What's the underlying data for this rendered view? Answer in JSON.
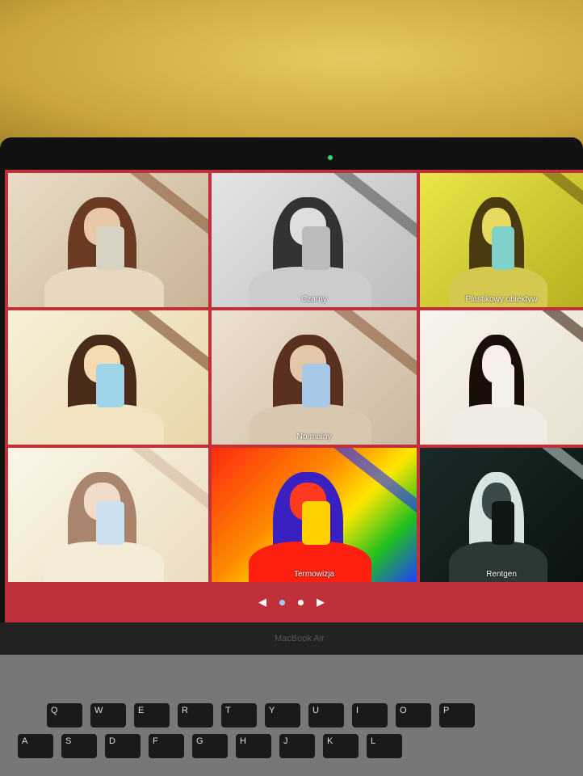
{
  "tiles": [
    {
      "label": ""
    },
    {
      "label": "Czarny"
    },
    {
      "label": "Plastikowy obiektyw"
    },
    {
      "label": ""
    },
    {
      "label": "Normalny"
    },
    {
      "label": ""
    },
    {
      "label": ""
    },
    {
      "label": "Termowizja"
    },
    {
      "label": "Rentgen"
    }
  ],
  "nav": {
    "prev": "◀",
    "next": "▶"
  },
  "laptop": {
    "brand": "MacBook Air"
  },
  "keys": {
    "row1": [
      "Q",
      "W",
      "E",
      "R",
      "T",
      "Y",
      "U",
      "I",
      "O",
      "P"
    ],
    "row2": [
      "A",
      "S",
      "D",
      "F",
      "G",
      "H",
      "J",
      "K",
      "L"
    ]
  }
}
